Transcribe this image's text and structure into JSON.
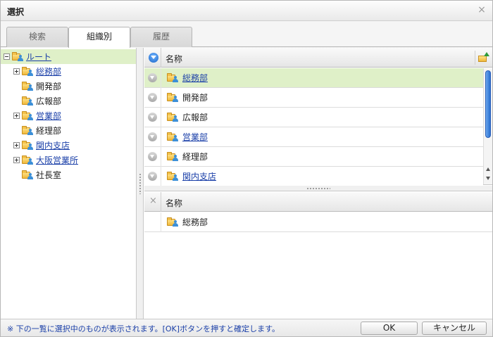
{
  "dialog": {
    "title": "選択",
    "close_glyph": "×"
  },
  "tabs": [
    {
      "label": "検索",
      "active": false
    },
    {
      "label": "組織別",
      "active": true
    },
    {
      "label": "履歴",
      "active": false
    }
  ],
  "tree": [
    {
      "label": "ルート",
      "expander": "minus",
      "link": true,
      "selected": true,
      "indent": 0
    },
    {
      "label": "総務部",
      "expander": "plus",
      "link": true,
      "selected": false,
      "indent": 1
    },
    {
      "label": "開発部",
      "expander": "none",
      "link": false,
      "selected": false,
      "indent": 1
    },
    {
      "label": "広報部",
      "expander": "none",
      "link": false,
      "selected": false,
      "indent": 1
    },
    {
      "label": "営業部",
      "expander": "plus",
      "link": true,
      "selected": false,
      "indent": 1
    },
    {
      "label": "経理部",
      "expander": "none",
      "link": false,
      "selected": false,
      "indent": 1
    },
    {
      "label": "関内支店",
      "expander": "plus",
      "link": true,
      "selected": false,
      "indent": 1
    },
    {
      "label": "大阪営業所",
      "expander": "plus",
      "link": true,
      "selected": false,
      "indent": 1
    },
    {
      "label": "社長室",
      "expander": "none",
      "link": false,
      "selected": false,
      "indent": 1
    }
  ],
  "candidates": {
    "header": "名称",
    "rows": [
      {
        "label": "総務部",
        "link": true,
        "selected": true
      },
      {
        "label": "開発部",
        "link": false,
        "selected": false
      },
      {
        "label": "広報部",
        "link": false,
        "selected": false
      },
      {
        "label": "営業部",
        "link": true,
        "selected": false
      },
      {
        "label": "経理部",
        "link": false,
        "selected": false
      },
      {
        "label": "関内支店",
        "link": true,
        "selected": false
      }
    ]
  },
  "selected_list": {
    "header": "名称",
    "remove_glyph": "×",
    "rows": [
      {
        "label": "総務部"
      }
    ]
  },
  "footer": {
    "note": "※ 下の一覧に選択中のものが表示されます。[OK]ボタンを押すと確定します。",
    "ok_label": "OK",
    "cancel_label": "キャンセル"
  },
  "colors": {
    "selected_row": "#dff0c8",
    "link": "#1a3fa8",
    "scroll_thumb": "#2a6fd0"
  }
}
